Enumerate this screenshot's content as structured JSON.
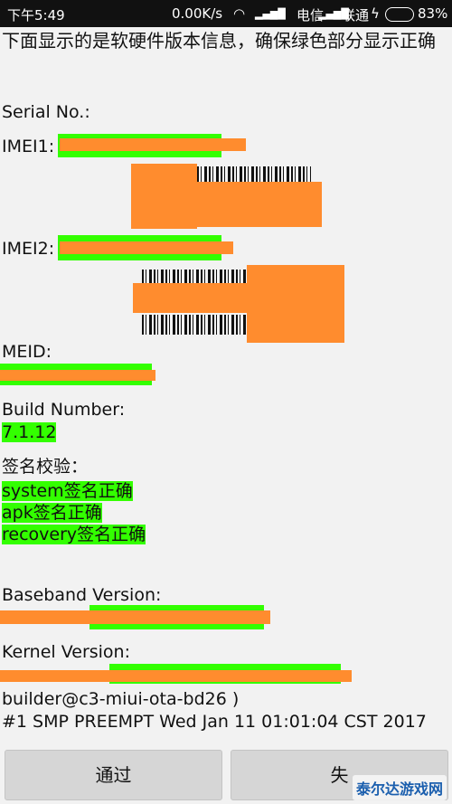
{
  "status_bar": {
    "time": "下午5:49",
    "speed": "0.00K/s",
    "carrier1": "电信",
    "carrier2": "联通",
    "battery": "83%"
  },
  "page": {
    "intro": "下面显示的是软硬件版本信息，确保绿色部分显示正确",
    "serial_label": "Serial No.:",
    "imei1_label": "IMEI1:",
    "imei2_label": "IMEI2:",
    "meid_label": "MEID:",
    "build_label": "Build Number:",
    "build_value": "7.1.12",
    "sign_label": "签名校验：",
    "sign_system": "system签名正确",
    "sign_apk": "apk签名正确",
    "sign_recovery": "recovery签名正确",
    "baseband_label": "Baseband Version:",
    "kernel_label": "Kernel Version:",
    "kernel_line2": "builder@c3-miui-ota-bd26 )",
    "kernel_line3": "#1 SMP PREEMPT Wed Jan 11 01:01:04 CST 2017"
  },
  "buttons": {
    "pass": "通过",
    "fail": "失"
  },
  "watermark": "泰尔达游戏网"
}
